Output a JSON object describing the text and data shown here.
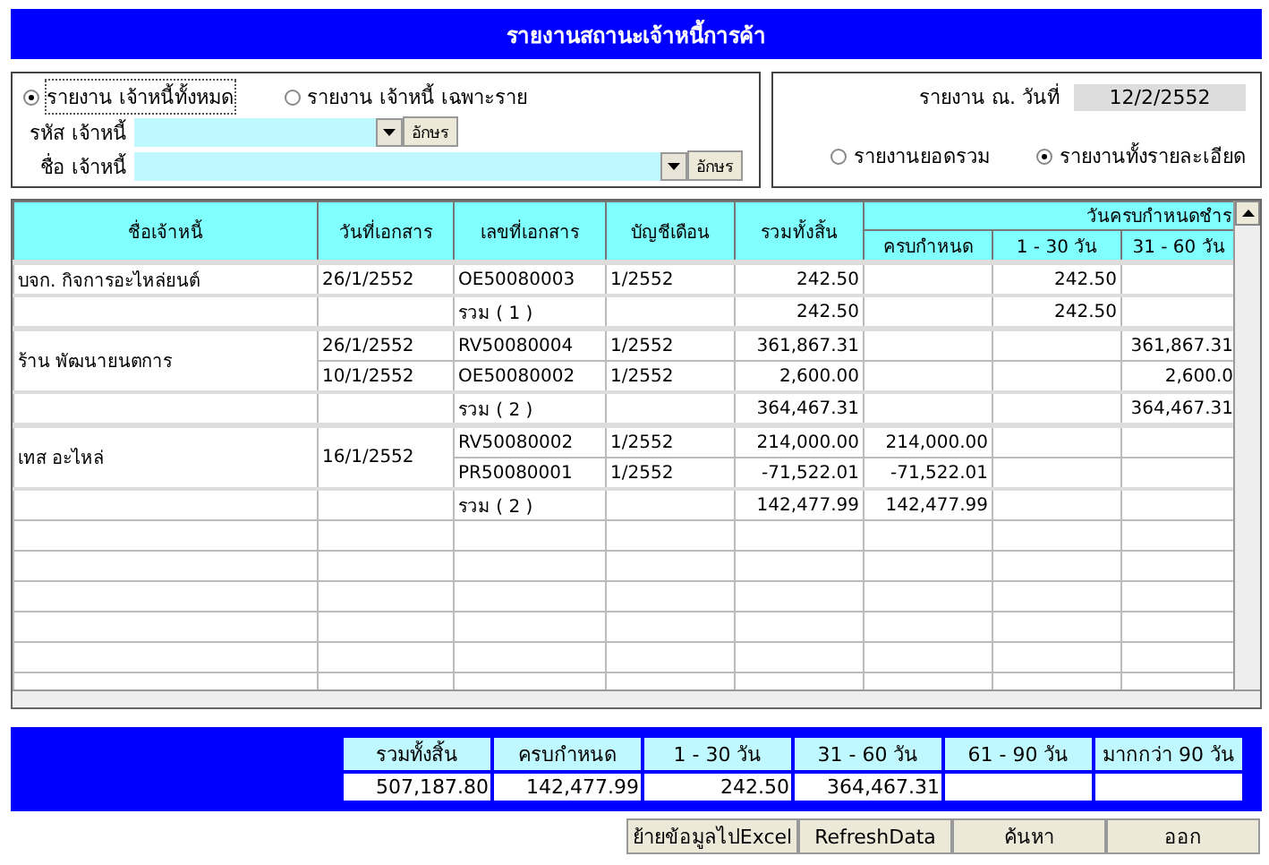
{
  "window": {
    "title": "รายงานสถานะเจ้าหนี้การค้า"
  },
  "scope_options": [
    {
      "label": "รายงาน เจ้าหนี้ทั้งหมด",
      "selected": true
    },
    {
      "label": "รายงาน เจ้าหนี้ เฉพาะราย",
      "selected": false
    }
  ],
  "filters": [
    {
      "label": "รหัส เจ้าหนี้",
      "button": "อักษร",
      "kind": "short"
    },
    {
      "label": "ชื่อ เจ้าหนี้",
      "button": "อักษร",
      "kind": "long"
    }
  ],
  "report_date": {
    "label": "รายงาน ณ. วันที่",
    "value": "12/2/2552"
  },
  "detail_options": [
    {
      "label": "รายงานยอดรวม",
      "selected": false
    },
    {
      "label": "รายงานทั้งรายละเอียด",
      "selected": true
    }
  ],
  "table": {
    "columns": [
      "ชื่อเจ้าหนี้",
      "วันที่เอกสาร",
      "เลขที่เอกสาร",
      "บัญชีเดือน",
      "รวมทั้งสิ้น"
    ],
    "group_header": "วันครบกำหนดชำร",
    "sub_columns": [
      "ครบกำหนด",
      "1 - 30 วัน",
      "31 - 60 วัน"
    ],
    "creditors": [
      {
        "name": "บจก.  กิจการอะไหล่ยนต์",
        "docs": [
          {
            "date": "26/1/2552",
            "number": "OE50080003",
            "month": "1/2552",
            "total": "242.50",
            "d30": "242.50"
          }
        ],
        "subtotal": {
          "label": "รวม ( 1 )",
          "total": "242.50",
          "d30": "242.50"
        }
      },
      {
        "name": "ร้าน  พัฒนายนตการ",
        "docs": [
          {
            "date": "26/1/2552",
            "number": "RV50080004",
            "month": "1/2552",
            "total": "361,867.31",
            "d60": "361,867.31"
          },
          {
            "date": "10/1/2552",
            "number": "OE50080002",
            "month": "1/2552",
            "total": "2,600.00",
            "d60": "2,600.0"
          }
        ],
        "subtotal": {
          "label": "รวม ( 2 )",
          "total": "364,467.31",
          "d60": "364,467.31"
        }
      },
      {
        "name": "เทส อะไหล่",
        "docs": [
          {
            "date": "16/1/2552",
            "number": "RV50080002",
            "month": "1/2552",
            "total": "214,000.00",
            "due": "214,000.00"
          },
          {
            "number": "PR50080001",
            "month": "1/2552",
            "total": "-71,522.01",
            "due": "-71,522.01"
          }
        ],
        "subtotal": {
          "label": "รวม ( 2 )",
          "total": "142,477.99",
          "due": "142,477.99"
        }
      }
    ]
  },
  "summary": [
    {
      "label": "รวมทั้งสิ้น",
      "value": "507,187.80"
    },
    {
      "label": "ครบกำหนด",
      "value": "142,477.99"
    },
    {
      "label": "1 - 30 วัน",
      "value": "242.50"
    },
    {
      "label": "31 - 60 วัน",
      "value": "364,467.31"
    },
    {
      "label": "61 - 90 วัน"
    },
    {
      "label": "มากกว่า 90 วัน"
    }
  ],
  "buttons": [
    "ย้ายข้อมูลไปExcel",
    "RefreshData",
    "ค้นหา",
    "ออก"
  ]
}
